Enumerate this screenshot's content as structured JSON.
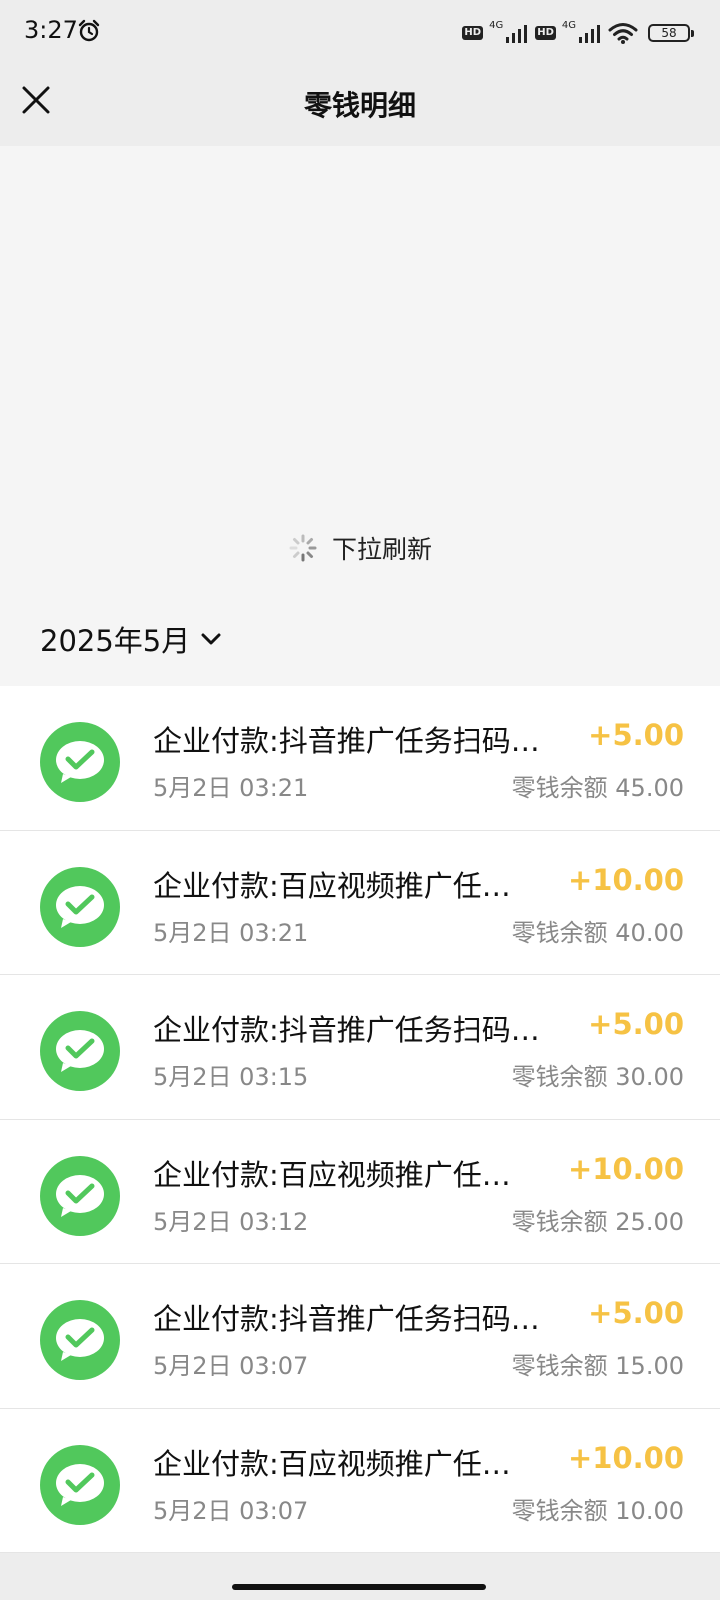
{
  "status": {
    "time": "3:27",
    "network1": "4G",
    "network2": "4G",
    "hd1": "HD",
    "hd2": "HD",
    "battery": "58"
  },
  "header": {
    "title": "零钱明细"
  },
  "refresh": {
    "label": "下拉刷新"
  },
  "month": {
    "label": "2025年5月"
  },
  "transactions": [
    {
      "title": "企业付款:抖音推广任务扫码…",
      "time": "5月2日 03:21",
      "amount": "+5.00",
      "balance": "零钱余额 45.00"
    },
    {
      "title": "企业付款:百应视频推广任…",
      "time": "5月2日 03:21",
      "amount": "+10.00",
      "balance": "零钱余额 40.00"
    },
    {
      "title": "企业付款:抖音推广任务扫码…",
      "time": "5月2日 03:15",
      "amount": "+5.00",
      "balance": "零钱余额 30.00"
    },
    {
      "title": "企业付款:百应视频推广任…",
      "time": "5月2日 03:12",
      "amount": "+10.00",
      "balance": "零钱余额 25.00"
    },
    {
      "title": "企业付款:抖音推广任务扫码…",
      "time": "5月2日 03:07",
      "amount": "+5.00",
      "balance": "零钱余额 15.00"
    },
    {
      "title": "企业付款:百应视频推广任…",
      "time": "5月2日 03:07",
      "amount": "+10.00",
      "balance": "零钱余额 10.00"
    }
  ],
  "colors": {
    "accent_green": "#51c85c",
    "amount_yellow": "#f6c244"
  }
}
